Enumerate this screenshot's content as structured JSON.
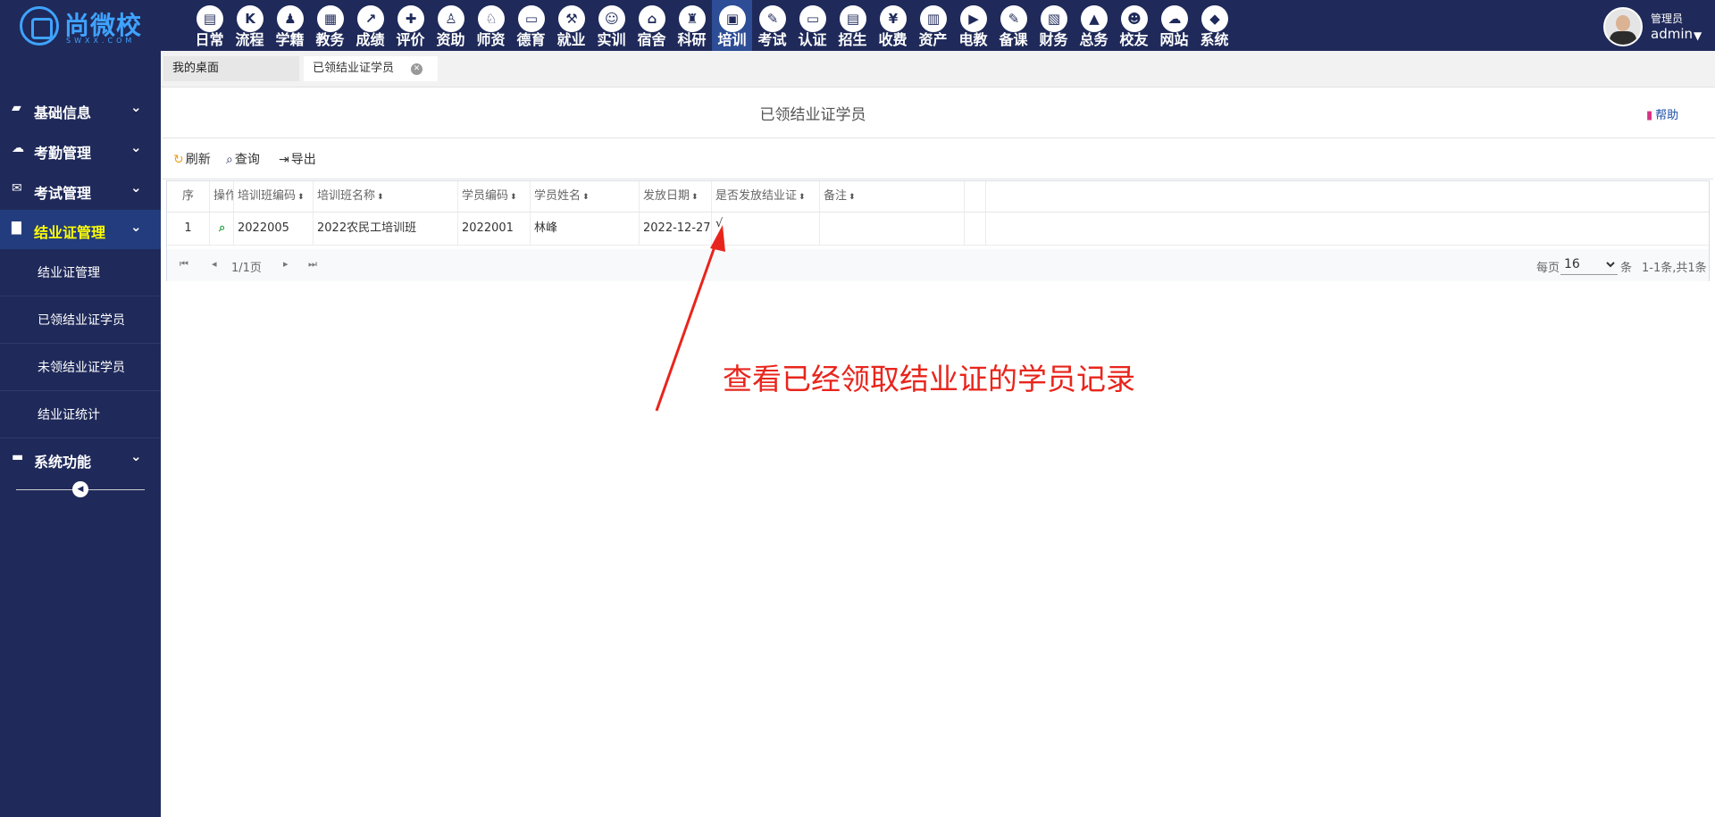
{
  "brand": {
    "name": "尚微校",
    "sub": "SWXX.COM"
  },
  "modules": [
    {
      "label": "日常",
      "icon": "calendar-icon",
      "glyph": "▤"
    },
    {
      "label": "流程",
      "icon": "flow-icon",
      "glyph": "K"
    },
    {
      "label": "学籍",
      "icon": "student-icon",
      "glyph": "♟"
    },
    {
      "label": "教务",
      "icon": "schedule-icon",
      "glyph": "▦"
    },
    {
      "label": "成绩",
      "icon": "chart-icon",
      "glyph": "↗"
    },
    {
      "label": "评价",
      "icon": "evaluate-icon",
      "glyph": "✚"
    },
    {
      "label": "资助",
      "icon": "aid-icon",
      "glyph": "♙"
    },
    {
      "label": "师资",
      "icon": "teacher-icon",
      "glyph": "♘"
    },
    {
      "label": "德育",
      "icon": "book-icon",
      "glyph": "▭"
    },
    {
      "label": "就业",
      "icon": "hammer-icon",
      "glyph": "⚒"
    },
    {
      "label": "实训",
      "icon": "train-icon",
      "glyph": "☺"
    },
    {
      "label": "宿舍",
      "icon": "home-icon",
      "glyph": "⌂"
    },
    {
      "label": "科研",
      "icon": "graduation-icon",
      "glyph": "♜"
    },
    {
      "label": "培训",
      "icon": "image-icon",
      "glyph": "▣"
    },
    {
      "label": "考试",
      "icon": "wrench-icon",
      "glyph": "✎"
    },
    {
      "label": "认证",
      "icon": "monitor-icon",
      "glyph": "▭"
    },
    {
      "label": "招生",
      "icon": "bus-icon",
      "glyph": "▤"
    },
    {
      "label": "收费",
      "icon": "yen-icon",
      "glyph": "¥"
    },
    {
      "label": "资产",
      "icon": "train-front-icon",
      "glyph": "▥"
    },
    {
      "label": "电教",
      "icon": "video-icon",
      "glyph": "▶"
    },
    {
      "label": "备课",
      "icon": "edit-icon",
      "glyph": "✎"
    },
    {
      "label": "财务",
      "icon": "news-icon",
      "glyph": "▧"
    },
    {
      "label": "总务",
      "icon": "stats-icon",
      "glyph": "▲"
    },
    {
      "label": "校友",
      "icon": "group-icon",
      "glyph": "☻"
    },
    {
      "label": "网站",
      "icon": "cloud-icon",
      "glyph": "☁"
    },
    {
      "label": "系统",
      "icon": "cube-icon",
      "glyph": "◆"
    }
  ],
  "active_module": "培训",
  "user": {
    "role": "管理员",
    "name": "admin"
  },
  "sidebar": {
    "groups": [
      {
        "label": "基础信息",
        "icon": "book-icon",
        "glyph": "▰"
      },
      {
        "label": "考勤管理",
        "icon": "cloud-icon",
        "glyph": "☁"
      },
      {
        "label": "考试管理",
        "icon": "envelope-icon",
        "glyph": "✉"
      },
      {
        "label": "结业证管理",
        "icon": "file-icon",
        "glyph": "▇"
      },
      {
        "label": "系统功能",
        "icon": "folder-icon",
        "glyph": "▬"
      }
    ],
    "active_group": "结业证管理",
    "sub_items": [
      "结业证管理",
      "已领结业证学员",
      "未领结业证学员",
      "结业证统计"
    ]
  },
  "tabs": [
    {
      "label": "我的桌面"
    },
    {
      "label": "已领结业证学员",
      "close": "✕"
    }
  ],
  "page": {
    "title": "已领结业证学员",
    "help": "帮助"
  },
  "toolbar": {
    "refresh": "刷新",
    "query": "查询",
    "export": "导出"
  },
  "table": {
    "columns": [
      "序",
      "操作",
      "培训班编码",
      "培训班名称",
      "学员编码",
      "学员姓名",
      "发放日期",
      "是否发放结业证",
      "备注"
    ],
    "rows": [
      {
        "seq": "1",
        "class_code": "2022005",
        "class_name": "2022农民工培训班",
        "student_code": "2022001",
        "student_name": "林峰",
        "issue_date": "2022-12-27",
        "issued": "√",
        "remark": ""
      }
    ]
  },
  "pager": {
    "page_info": "1/1页",
    "per_page_label": "每页",
    "per_page_value": "16",
    "unit": "条",
    "summary": "1-1条,共1条"
  },
  "annotation": {
    "text": "查看已经领取结业证的学员记录",
    "color": "#e8251c"
  },
  "colors": {
    "nav_bg": "#1f2a5a",
    "active_module": "#2d4d96",
    "active_sidebar_text": "#ffff00",
    "link": "#1c4fa8",
    "refresh_icon": "#f0a020",
    "search_icon": "#2a9d3c"
  }
}
